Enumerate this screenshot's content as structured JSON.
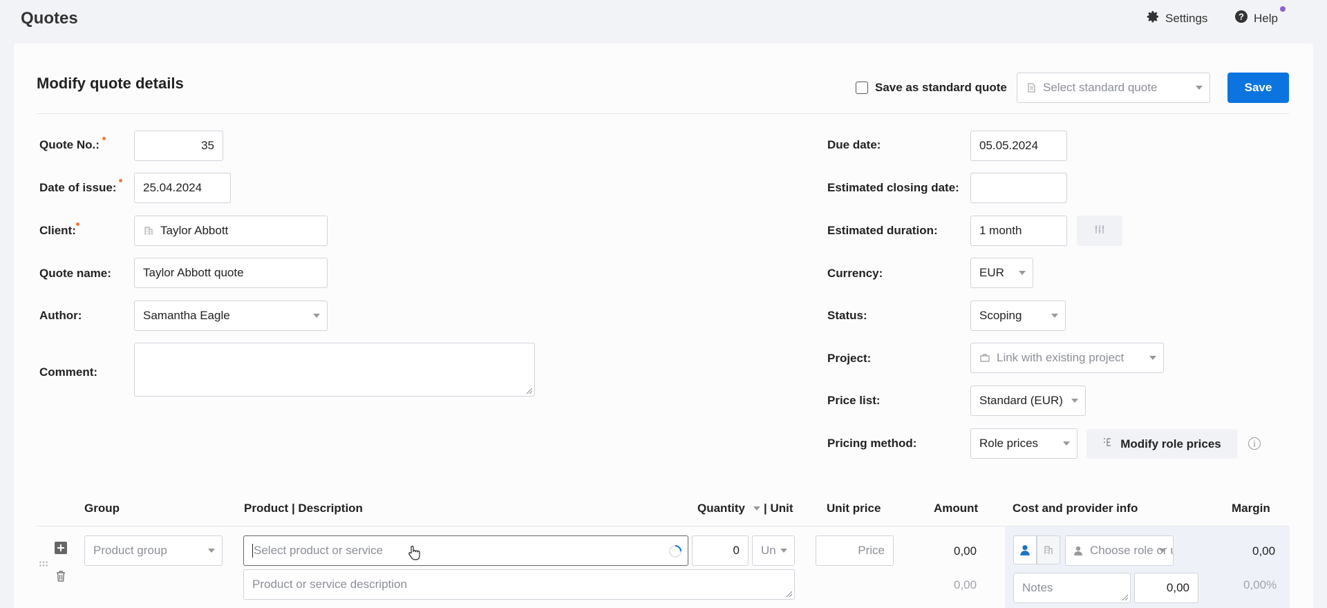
{
  "header": {
    "title": "Quotes",
    "settings_label": "Settings",
    "help_label": "Help"
  },
  "card": {
    "title": "Modify quote details",
    "save_standard_label": "Save as standard quote",
    "select_standard_placeholder": "Select standard quote",
    "save_label": "Save"
  },
  "left_form": {
    "quote_no_label": "Quote No.:",
    "quote_no_value": "35",
    "date_issue_label": "Date of issue:",
    "date_issue_value": "25.04.2024",
    "client_label": "Client:",
    "client_value": "Taylor Abbott",
    "quote_name_label": "Quote name:",
    "quote_name_value": "Taylor Abbott quote",
    "author_label": "Author:",
    "author_value": "Samantha Eagle",
    "comment_label": "Comment:"
  },
  "right_form": {
    "due_date_label": "Due date:",
    "due_date_value": "05.05.2024",
    "closing_date_label": "Estimated closing date:",
    "duration_label": "Estimated duration:",
    "duration_value": "1 month",
    "currency_label": "Currency:",
    "currency_value": "EUR",
    "status_label": "Status:",
    "status_value": "Scoping",
    "project_label": "Project:",
    "project_placeholder": "Link with existing project",
    "price_list_label": "Price list:",
    "price_list_value": "Standard (EUR)",
    "pricing_method_label": "Pricing method:",
    "pricing_method_value": "Role prices",
    "modify_role_prices_label": "Modify role prices"
  },
  "table": {
    "col_group": "Group",
    "col_product": "Product | Description",
    "col_quantity": "Quantity",
    "col_unit": "| Unit",
    "col_unit_price": "Unit price",
    "col_amount": "Amount",
    "col_cost": "Cost and provider info",
    "col_margin": "Margin",
    "row": {
      "group_placeholder": "Product group",
      "product_placeholder": "Select product or service",
      "quantity": "0",
      "unit_placeholder": "Un",
      "price_placeholder": "Price",
      "amount": "0,00",
      "description_placeholder": "Product or service description",
      "amount_secondary": "0,00",
      "role_placeholder": "Choose role or u",
      "margin": "0,00",
      "notes_placeholder": "Notes",
      "cost_value": "0,00",
      "margin_pct": "0,00%"
    }
  },
  "colors": {
    "accent": "#0b74de",
    "required_dot": "#f07a3a",
    "notification_dot": "#8a63d2"
  }
}
